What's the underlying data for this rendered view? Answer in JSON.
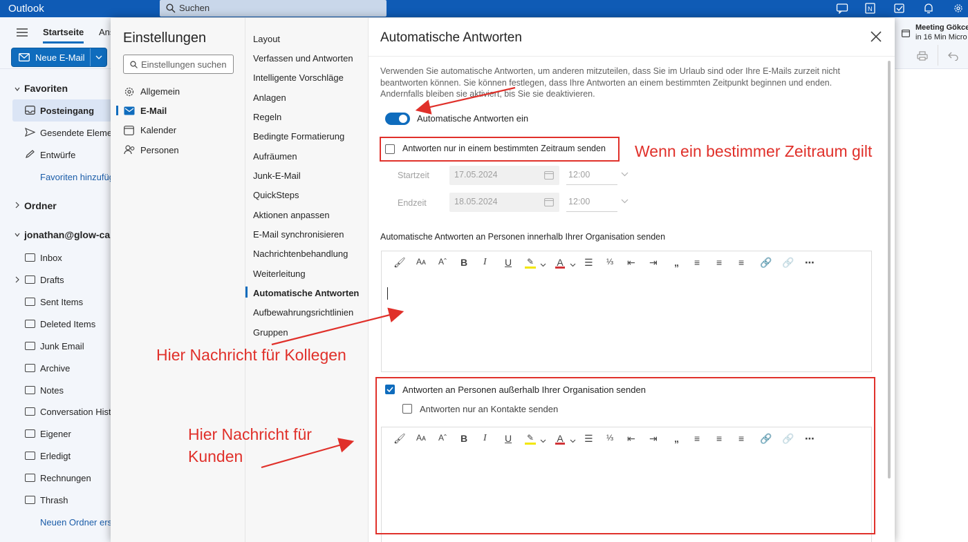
{
  "app": {
    "title": "Outlook",
    "search_placeholder": "Suchen"
  },
  "ribbon": {
    "tab_start": "Startseite",
    "tab_view": "Ans",
    "new_mail": "Neue E-Mail"
  },
  "meeting": {
    "line1": "Meeting Gökce",
    "line2": "in 16 Min Micro"
  },
  "sidebar": {
    "favorites": "Favoriten",
    "fav_items": [
      "Posteingang",
      "Gesendete Elemente",
      "Entwürfe"
    ],
    "fav_add": "Favoriten hinzufügen",
    "folders": "Ordner",
    "account": "jonathan@glow-ca",
    "account_items": [
      "Inbox",
      "Drafts",
      "Sent Items",
      "Deleted Items",
      "Junk Email",
      "Archive",
      "Notes",
      "Conversation History",
      "Eigener",
      "Erledigt",
      "Rechnungen",
      "Thrash"
    ],
    "new_folder": "Neuen Ordner erstellen"
  },
  "settings": {
    "title": "Einstellungen",
    "search_placeholder": "Einstellungen suchen",
    "categories": [
      "Allgemein",
      "E-Mail",
      "Kalender",
      "Personen"
    ],
    "subcategories": [
      "Layout",
      "Verfassen und Antworten",
      "Intelligente Vorschläge",
      "Anlagen",
      "Regeln",
      "Bedingte Formatierung",
      "Aufräumen",
      "Junk-E-Mail",
      "QuickSteps",
      "Aktionen anpassen",
      "E-Mail synchronisieren",
      "Nachrichtenbehandlung",
      "Weiterleitung",
      "Automatische Antworten",
      "Aufbewahrungsrichtlinien",
      "Gruppen"
    ]
  },
  "pane": {
    "title": "Automatische Antworten",
    "description": "Verwenden Sie automatische Antworten, um anderen mitzuteilen, dass Sie im Urlaub sind oder Ihre E-Mails zurzeit nicht beantworten können. Sie können festlegen, dass Ihre Antworten an einem bestimmten Zeitpunkt beginnen und enden. Andernfalls bleiben sie aktiviert, bis Sie sie deaktivieren.",
    "toggle_label": "Automatische Antworten ein",
    "toggle_on": true,
    "period_label": "Antworten nur in einem bestimmten Zeitraum senden",
    "start_label": "Startzeit",
    "start_date": "17.05.2024",
    "start_time": "12:00",
    "end_label": "Endzeit",
    "end_date": "18.05.2024",
    "end_time": "12:00",
    "internal_label": "Automatische Antworten an Personen innerhalb Ihrer Organisation senden",
    "external_label": "Antworten an Personen außerhalb Ihrer Organisation senden",
    "external_checked": true,
    "contacts_only_label": "Antworten nur an Kontakte senden"
  },
  "annotations": {
    "period": "Wenn ein bestimmer Zeitraum gilt",
    "colleagues": "Hier Nachricht für Kollegen",
    "customers_1": "Hier Nachricht für",
    "customers_2": "Kunden"
  },
  "colors": {
    "brand": "#0f5bb5",
    "accent": "#0f6cbd",
    "annotation": "#e0302a"
  }
}
